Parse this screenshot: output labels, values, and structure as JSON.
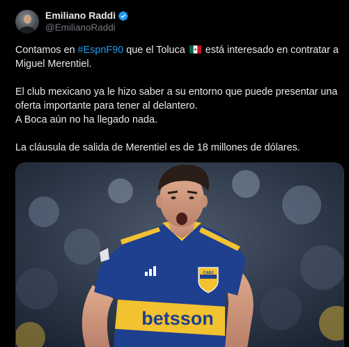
{
  "author": {
    "display_name": "Emiliano Raddi",
    "handle": "@EmilianoRaddi",
    "verified": true,
    "avatar_icon": "profile-photo"
  },
  "tweet": {
    "p1_before": "Contamos en ",
    "hashtag": "#EspnF90",
    "p1_middle": " que el Toluca ",
    "flag_icon": "mexico-flag",
    "p1_after": " está interesado en contratar a Miguel Merentiel.",
    "p2_line1": "El club mexicano ya le hizo saber a su entorno que puede presentar una oferta importante para tener al delantero.",
    "p2_line2": "A Boca aún no ha llegado nada.",
    "p3": "La cláusula de salida de Merentiel es de 18 millones de dólares."
  },
  "media": {
    "description_icon": "football-player-photo",
    "jersey_sponsor": "betsson",
    "crest_text": "CABJ"
  },
  "colors": {
    "background": "#000000",
    "text": "#e7e9ea",
    "muted": "#71767b",
    "link": "#1d9bf0",
    "verified": "#1d9bf0",
    "jersey_blue": "#1f3f8f",
    "jersey_yellow": "#f2c230"
  }
}
